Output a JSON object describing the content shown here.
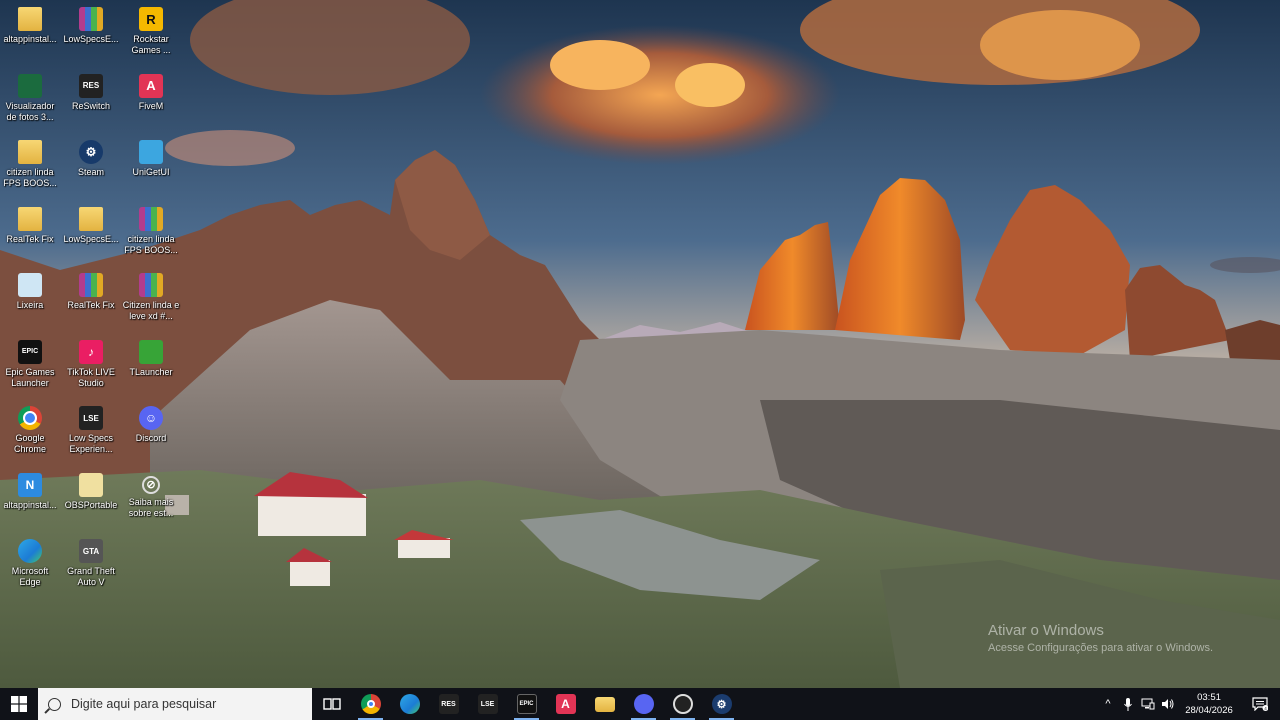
{
  "desktop": {
    "icons": [
      {
        "label": "altappinstal...",
        "icon": "folder-icon"
      },
      {
        "label": "LowSpecsE...",
        "icon": "winrar-icon"
      },
      {
        "label": "Rockstar Games ...",
        "icon": "rockstar-icon"
      },
      {
        "label": "Visualizador de fotos 3...",
        "icon": "photo-viewer-icon"
      },
      {
        "label": "ReSwitch",
        "icon": "reswitch-icon"
      },
      {
        "label": "FiveM",
        "icon": "fivem-icon"
      },
      {
        "label": "citizen linda FPS BOOS...",
        "icon": "folder-icon"
      },
      {
        "label": "Steam",
        "icon": "steam-icon"
      },
      {
        "label": "UniGetUI",
        "icon": "unigetui-icon"
      },
      {
        "label": "RealTek Fix",
        "icon": "folder-icon"
      },
      {
        "label": "LowSpecsE...",
        "icon": "folder-icon"
      },
      {
        "label": "citizen linda FPS BOOS...",
        "icon": "winrar-icon"
      },
      {
        "label": "Lixeira",
        "icon": "recycle-bin-icon"
      },
      {
        "label": "RealTek Fix",
        "icon": "winrar-icon"
      },
      {
        "label": "Citizen linda e leve xd #...",
        "icon": "winrar-icon"
      },
      {
        "label": "Epic Games Launcher",
        "icon": "epic-games-icon"
      },
      {
        "label": "TikTok LIVE Studio",
        "icon": "tiktok-icon"
      },
      {
        "label": "TLauncher",
        "icon": "tlauncher-icon"
      },
      {
        "label": "Google Chrome",
        "icon": "chrome-icon"
      },
      {
        "label": "Low Specs Experien...",
        "icon": "lse-icon"
      },
      {
        "label": "Discord",
        "icon": "discord-icon"
      },
      {
        "label": "altappinstal...",
        "icon": "altappinstaller-icon"
      },
      {
        "label": "OBSPortable",
        "icon": "obs-icon"
      },
      {
        "label": "Saiba mais sobre est...",
        "icon": "info-icon"
      },
      {
        "label": "Microsoft Edge",
        "icon": "edge-icon"
      },
      {
        "label": "Grand Theft Auto V",
        "icon": "gta-icon"
      }
    ],
    "glyphs": {
      "rockstar": "R",
      "res": "RES",
      "fivem": "A",
      "steam": "⚙",
      "epic": "EPIC",
      "tiktok": "♪",
      "lse": "LSE",
      "discord": "☺",
      "altapp": "N",
      "info": "⊘",
      "gta": "GTA"
    }
  },
  "watermark": {
    "title": "Ativar o Windows",
    "subtitle": "Acesse Configurações para ativar o Windows."
  },
  "taskbar": {
    "search_placeholder": "Digite aqui para pesquisar",
    "apps": [
      {
        "name": "task-view",
        "label": ""
      },
      {
        "name": "chrome",
        "label": ""
      },
      {
        "name": "edge",
        "label": ""
      },
      {
        "name": "reswitch",
        "label": "RES"
      },
      {
        "name": "lse",
        "label": "LSE"
      },
      {
        "name": "epic-games",
        "label": "EPIC"
      },
      {
        "name": "fivem",
        "label": "A"
      },
      {
        "name": "file-explorer",
        "label": ""
      },
      {
        "name": "discord",
        "label": ""
      },
      {
        "name": "obs",
        "label": ""
      },
      {
        "name": "steam",
        "label": ""
      }
    ],
    "tray": {
      "chevron": "^",
      "mic": "🎤",
      "network": "🖧",
      "volume": "🔊",
      "time": "03:51",
      "date": "28/04/2026"
    }
  },
  "colors": {
    "taskbar_bg": "#101218",
    "search_bg": "#f3f3f3",
    "active_indicator": "#7fb3f0"
  }
}
